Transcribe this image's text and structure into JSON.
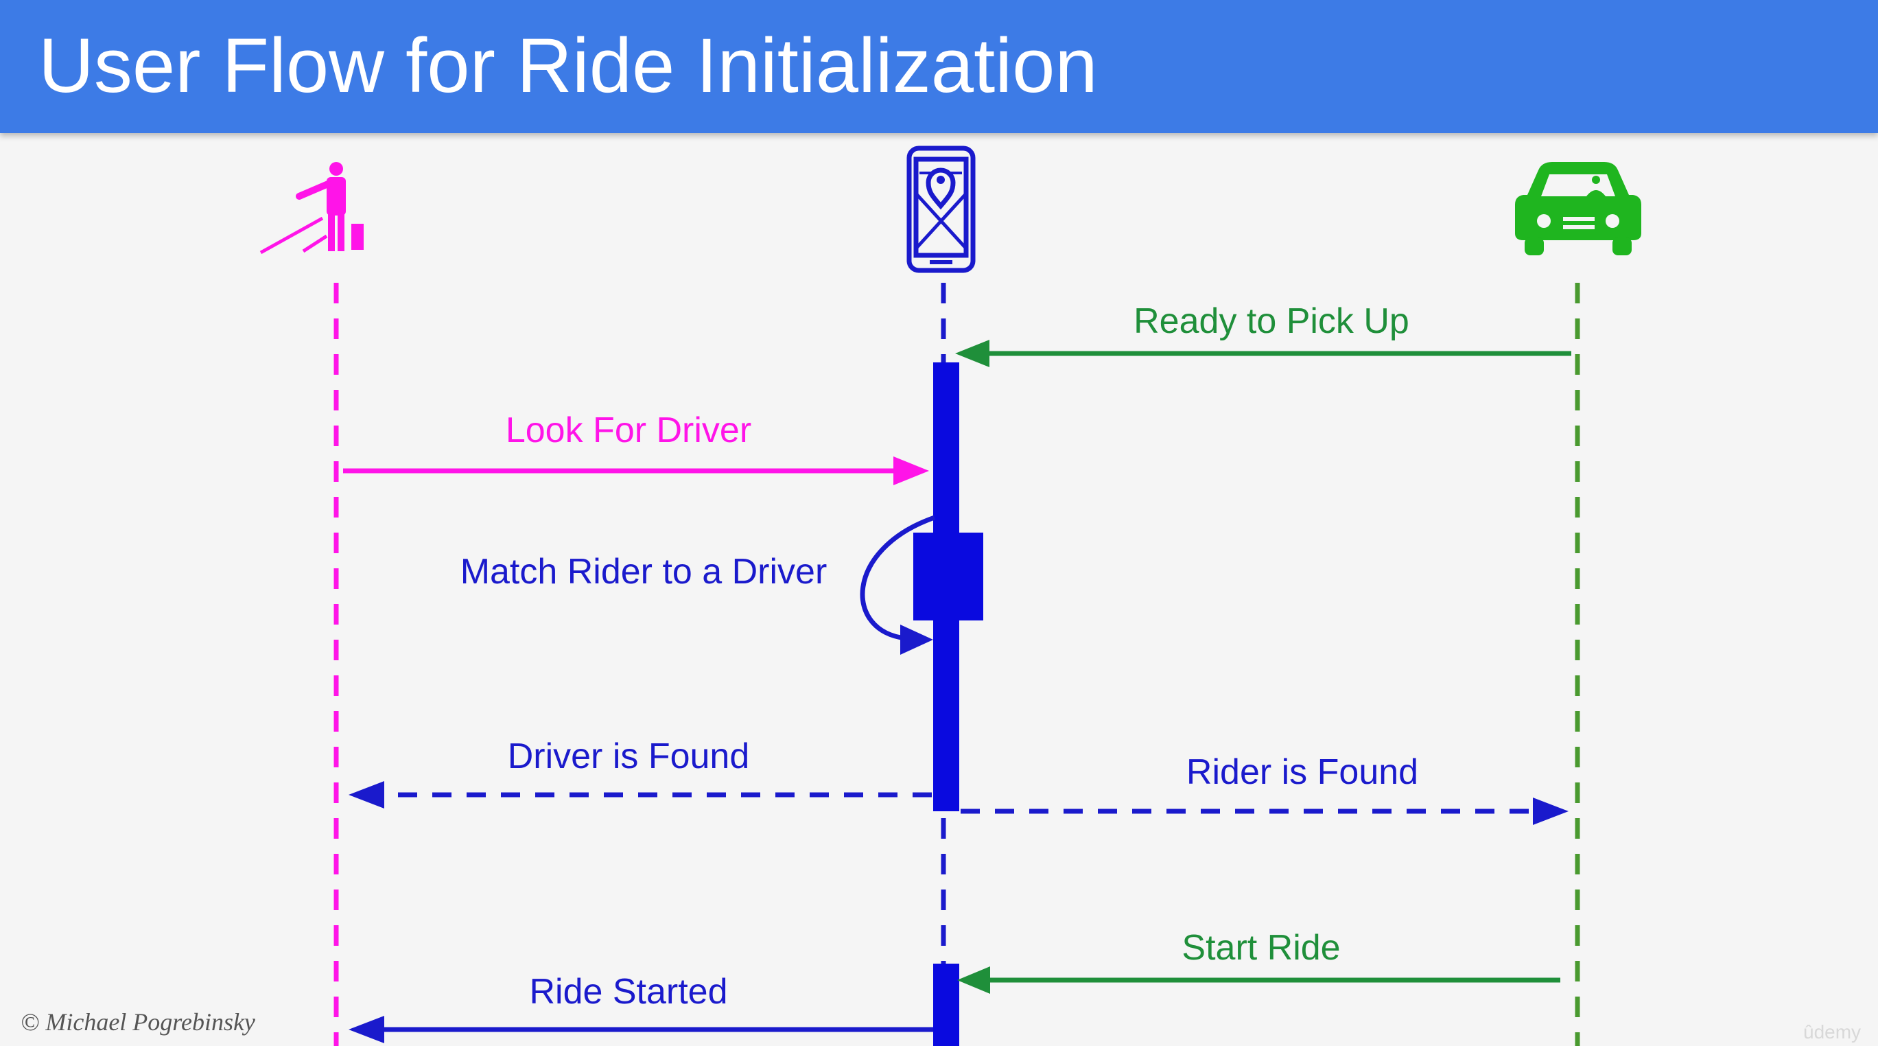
{
  "title": "User Flow for Ride Initialization",
  "participants": [
    {
      "id": "rider",
      "icon": "rider-hailing-icon",
      "color": "#ff14e8"
    },
    {
      "id": "app",
      "icon": "phone-map-app-icon",
      "color": "#1a1aff"
    },
    {
      "id": "driver",
      "icon": "driver-car-icon",
      "color": "#1fb51f"
    }
  ],
  "messages": [
    {
      "from": "driver",
      "to": "app",
      "label": "Ready to Pick Up",
      "style": "solid",
      "color": "#1f8f3a"
    },
    {
      "from": "rider",
      "to": "app",
      "label": "Look For Driver",
      "style": "solid",
      "color": "#ff14e8"
    },
    {
      "from": "app",
      "to": "app",
      "label": "Match Rider to a Driver",
      "style": "self",
      "color": "#1a1acc"
    },
    {
      "from": "app",
      "to": "rider",
      "label": "Driver is Found",
      "style": "dashed",
      "color": "#1a1acc"
    },
    {
      "from": "app",
      "to": "driver",
      "label": "Rider is Found",
      "style": "dashed",
      "color": "#1a1acc"
    },
    {
      "from": "driver",
      "to": "app",
      "label": "Start Ride",
      "style": "solid",
      "color": "#1f8f3a"
    },
    {
      "from": "app",
      "to": "rider",
      "label": "Ride Started",
      "style": "solid",
      "color": "#1a1acc"
    }
  ],
  "copyright": "© Michael Pogrebinsky",
  "watermark": "ûdemy"
}
